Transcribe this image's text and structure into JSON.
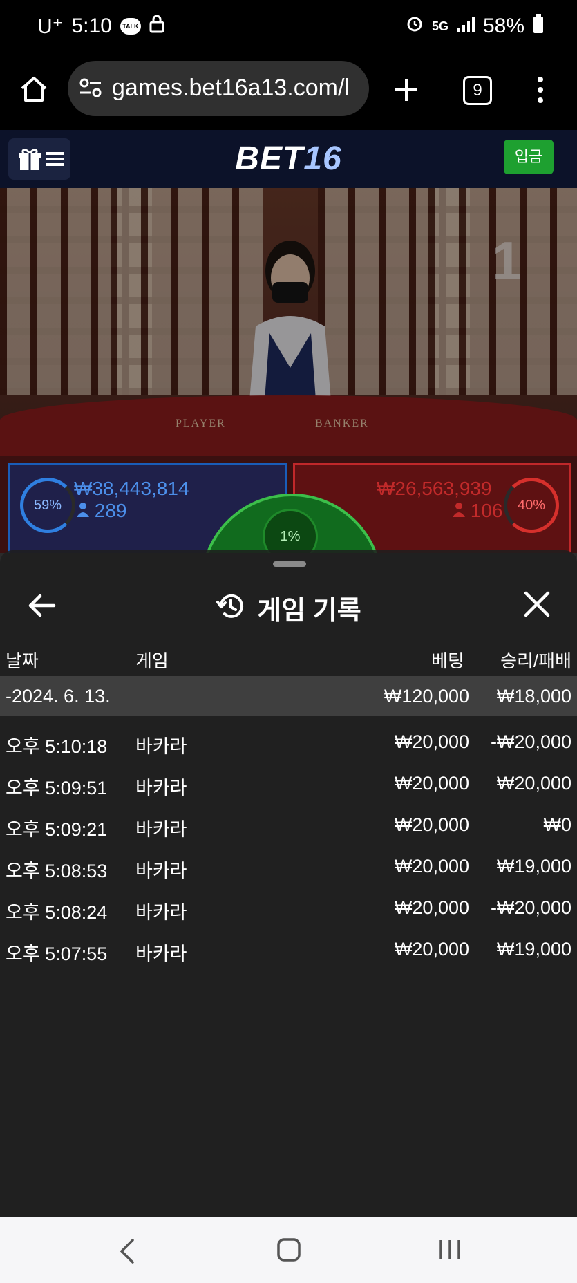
{
  "status_bar": {
    "carrier": "U⁺",
    "time": "5:10",
    "talk_badge": "TALK",
    "network": "5G",
    "battery": "58%"
  },
  "browser": {
    "url": "games.bet16a13.com/l",
    "tab_count": "9"
  },
  "site": {
    "logo_part1": "BET",
    "logo_part2": "16",
    "deposit_label": "입금"
  },
  "video": {
    "table_player": "PLAYER",
    "table_banker": "BANKER",
    "round_number": "1"
  },
  "bets": {
    "player": {
      "percent": "59%",
      "amount": "₩38,443,814",
      "count": "289"
    },
    "banker": {
      "percent": "40%",
      "amount": "₩26,563,939",
      "count": "106"
    },
    "tie": {
      "percent": "1%"
    }
  },
  "history_sheet": {
    "title": "게임 기록",
    "columns": {
      "date": "날짜",
      "game": "게임",
      "bet": "베팅",
      "result": "승리/패배"
    },
    "summary": {
      "date": "-2024. 6. 13.",
      "bet": "₩120,000",
      "result": "₩18,000"
    },
    "rows": [
      {
        "time": "오후 5:10:18",
        "game": "바카라",
        "bet": "₩20,000",
        "result": "-₩20,000"
      },
      {
        "time": "오후 5:09:51",
        "game": "바카라",
        "bet": "₩20,000",
        "result": "₩20,000"
      },
      {
        "time": "오후 5:09:21",
        "game": "바카라",
        "bet": "₩20,000",
        "result": "₩0"
      },
      {
        "time": "오후 5:08:53",
        "game": "바카라",
        "bet": "₩20,000",
        "result": "₩19,000"
      },
      {
        "time": "오후 5:08:24",
        "game": "바카라",
        "bet": "₩20,000",
        "result": "-₩20,000"
      },
      {
        "time": "오후 5:07:55",
        "game": "바카라",
        "bet": "₩20,000",
        "result": "₩19,000"
      }
    ]
  },
  "colors": {
    "player_blue": "#1a5db8",
    "banker_red": "#c0282a",
    "tie_green": "#3cbf4a",
    "deposit_green": "#1ea030",
    "header_navy": "#0c1229"
  }
}
